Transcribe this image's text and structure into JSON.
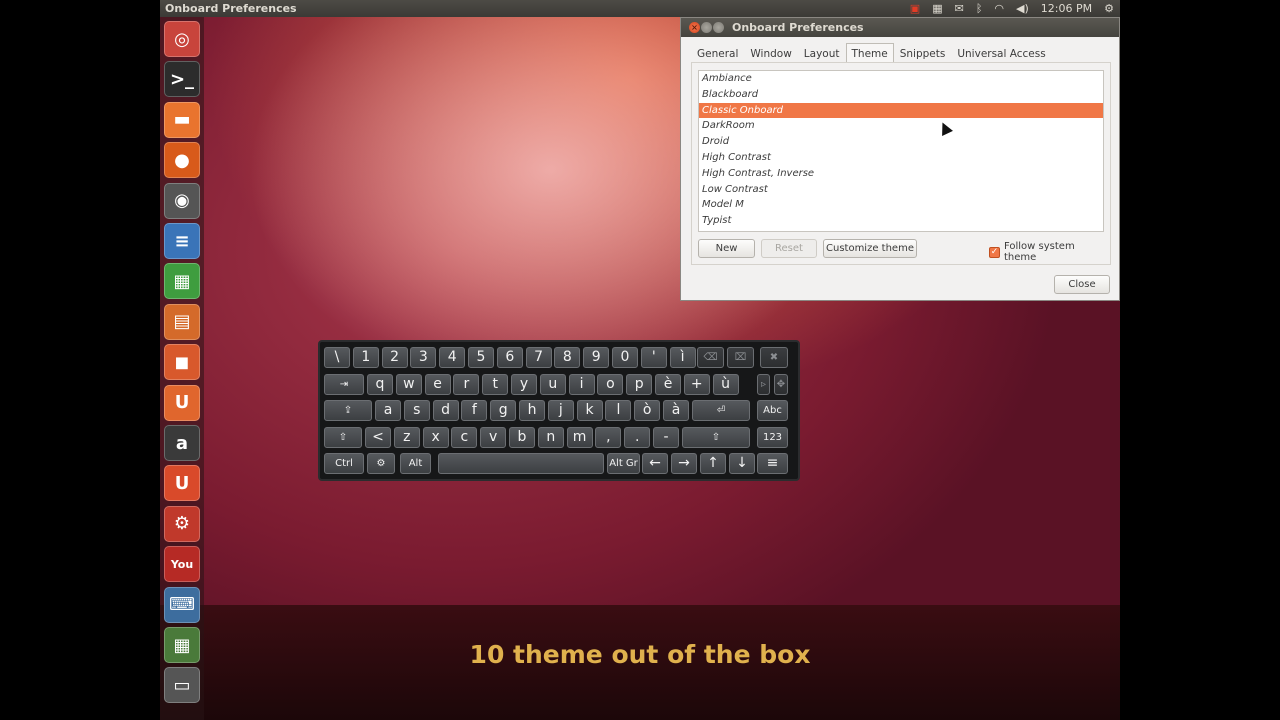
{
  "top_panel": {
    "app_title": "Onboard Preferences",
    "clock": "12:06 PM",
    "indicators": [
      "keyboard-indicator-icon",
      "workspaces-icon",
      "mail-icon",
      "bluetooth-icon",
      "wifi-icon",
      "volume-icon",
      "gear-icon"
    ]
  },
  "launcher": {
    "items": [
      {
        "name": "dash-home",
        "glyph": "◎",
        "color": "#c8443c"
      },
      {
        "name": "terminal",
        "glyph": ">_",
        "color": "#2c2c2c"
      },
      {
        "name": "files",
        "glyph": "▬",
        "color": "#e9742e"
      },
      {
        "name": "firefox",
        "glyph": "●",
        "color": "#d85a1a"
      },
      {
        "name": "screenshot",
        "glyph": "◉",
        "color": "#555"
      },
      {
        "name": "writer",
        "glyph": "≡",
        "color": "#3a74b8"
      },
      {
        "name": "calc",
        "glyph": "▦",
        "color": "#3f9d3f"
      },
      {
        "name": "impress",
        "glyph": "▤",
        "color": "#d46a2a"
      },
      {
        "name": "software-center",
        "glyph": "◼",
        "color": "#d8592c"
      },
      {
        "name": "ubuntu-one",
        "glyph": "U",
        "color": "#e0662d"
      },
      {
        "name": "amazon",
        "glyph": "a",
        "color": "#3a3a3a"
      },
      {
        "name": "ubuntu-one-music",
        "glyph": "U",
        "color": "#d94a2a"
      },
      {
        "name": "system-settings",
        "glyph": "⚙",
        "color": "#c0392b"
      },
      {
        "name": "youtube",
        "glyph": "You",
        "color": "#b62a25"
      },
      {
        "name": "onboard",
        "glyph": "⌨",
        "color": "#3d6d9e"
      },
      {
        "name": "workspace-switcher",
        "glyph": "▦",
        "color": "#4a7a3a"
      },
      {
        "name": "trash",
        "glyph": "▭",
        "color": "#555"
      }
    ]
  },
  "prefs": {
    "window_title": "Onboard Preferences",
    "tabs": [
      "General",
      "Window",
      "Layout",
      "Theme",
      "Snippets",
      "Universal Access"
    ],
    "active_tab": "Theme",
    "themes": [
      "Ambiance",
      "Blackboard",
      "Classic Onboard",
      "DarkRoom",
      "Droid",
      "High Contrast",
      "High Contrast, Inverse",
      "Low Contrast",
      "Model M",
      "Typist"
    ],
    "selected_theme": "Classic Onboard",
    "buttons": {
      "new": "New",
      "reset": "Reset",
      "customize": "Customize theme",
      "close": "Close"
    },
    "follow_system_theme": {
      "label": "Follow system theme",
      "checked": true
    }
  },
  "keyboard": {
    "row1": [
      "\\",
      "1",
      "2",
      "3",
      "4",
      "5",
      "6",
      "7",
      "8",
      "9",
      "0",
      "'",
      "ì",
      "⌫",
      "⌧",
      "✖"
    ],
    "row2": [
      "⇥",
      "q",
      "w",
      "e",
      "r",
      "t",
      "y",
      "u",
      "i",
      "o",
      "p",
      "è",
      "+",
      "ù",
      "▹",
      "✥"
    ],
    "row3": [
      "⇪",
      "a",
      "s",
      "d",
      "f",
      "g",
      "h",
      "j",
      "k",
      "l",
      "ò",
      "à",
      "⏎",
      "Abc"
    ],
    "row4": [
      "⇧",
      "<",
      "z",
      "x",
      "c",
      "v",
      "b",
      "n",
      "m",
      ",",
      ".",
      "-",
      "⇧",
      "123"
    ],
    "row5": [
      "Ctrl",
      "⚙",
      "Alt",
      "",
      "Alt Gr",
      "←",
      "→",
      "↑",
      "↓",
      "≡"
    ]
  },
  "caption": "10 theme out of the box"
}
